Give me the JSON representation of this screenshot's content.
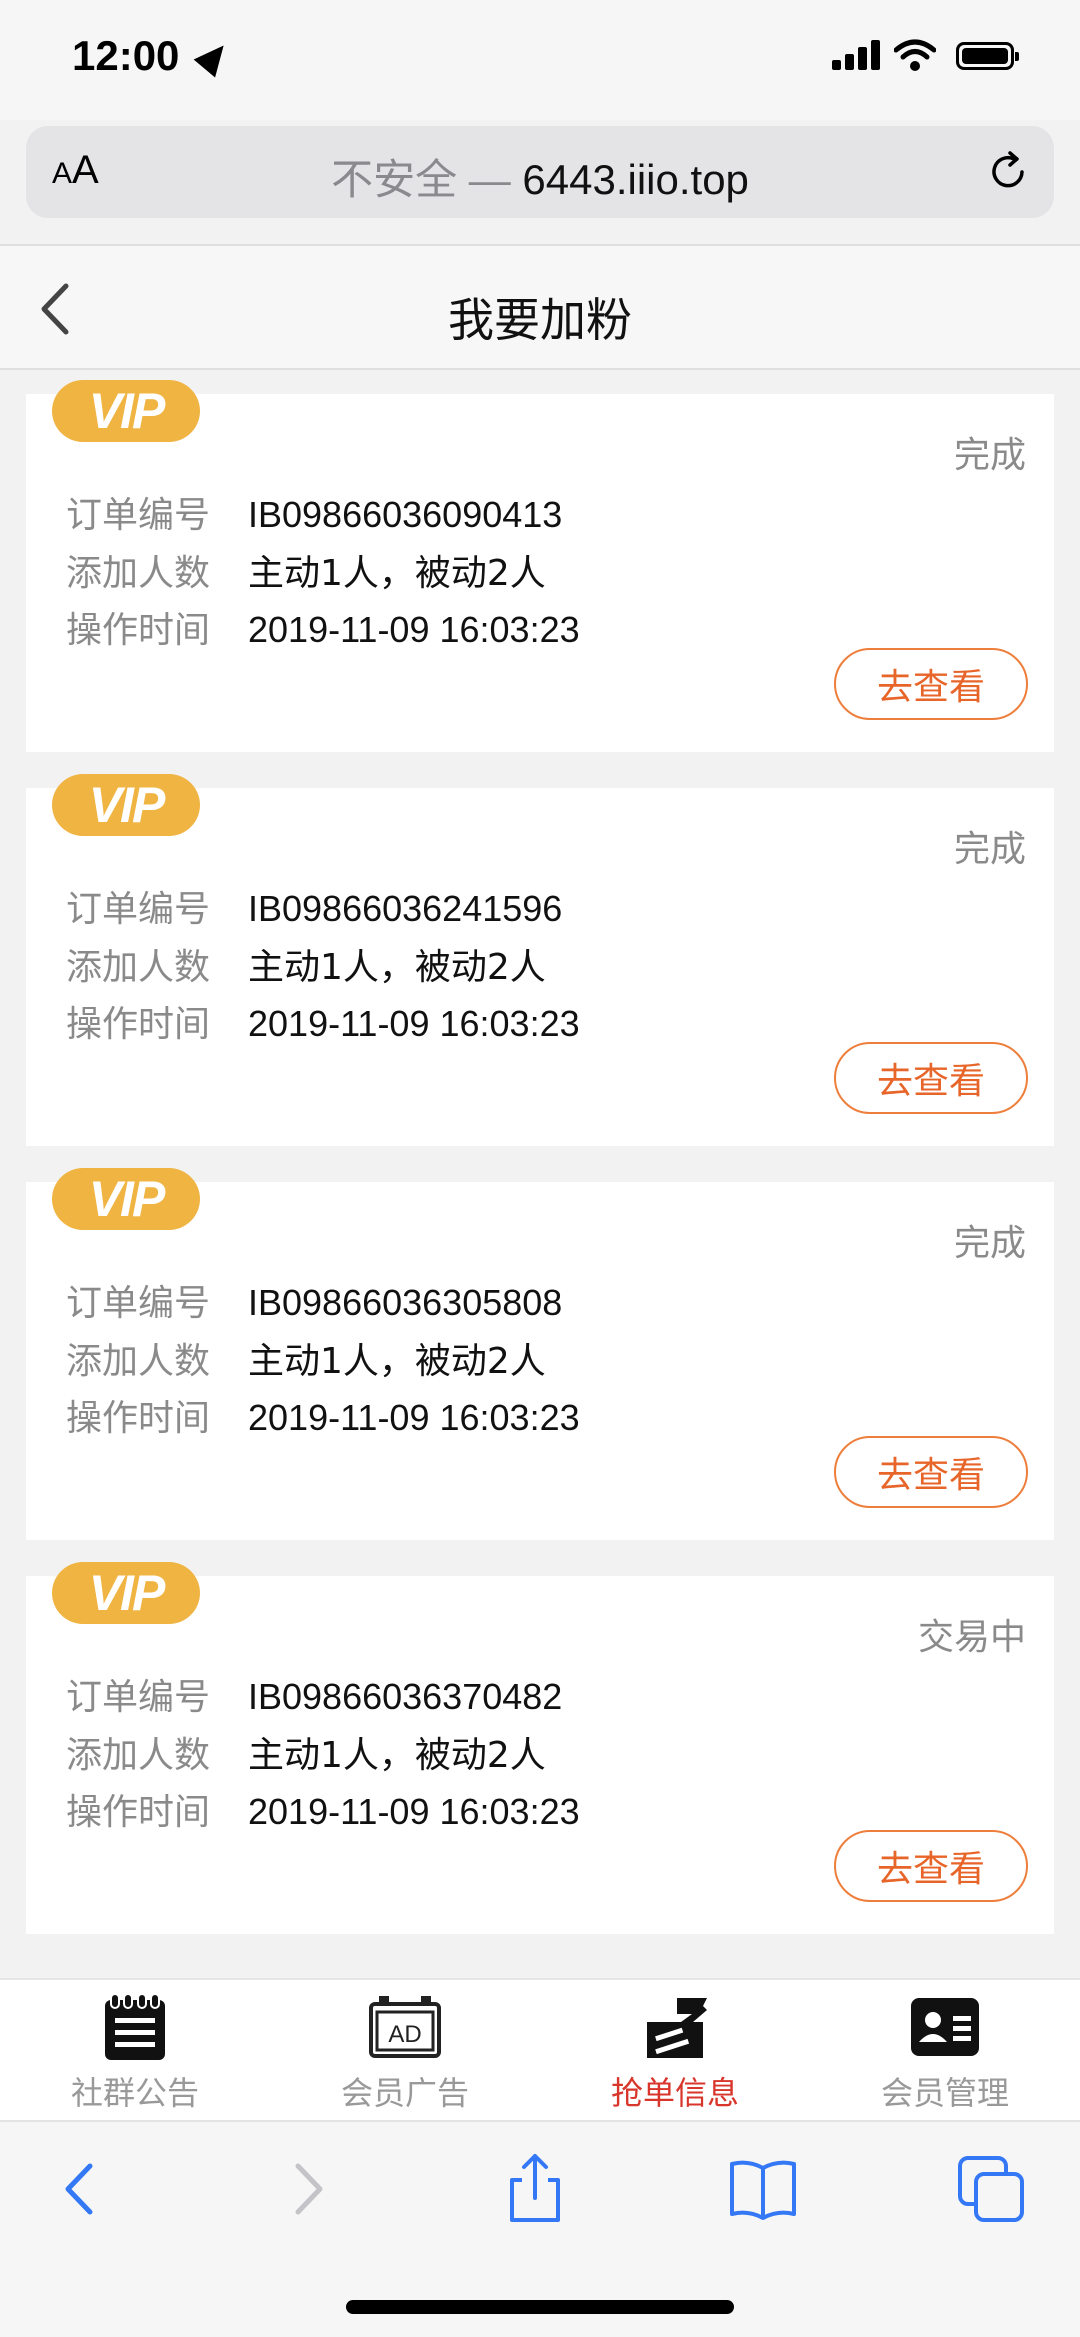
{
  "status_bar": {
    "time": "12:00"
  },
  "browser": {
    "aa_small": "A",
    "aa_big": "A",
    "insecure_label": "不安全 — ",
    "host": "6443.iiio.top"
  },
  "header": {
    "title": "我要加粉"
  },
  "labels": {
    "order_no": "订单编号",
    "add_count": "添加人数",
    "op_time": "操作时间",
    "view_button": "去查看",
    "vip": "VIP"
  },
  "orders": [
    {
      "status": "完成",
      "order_no": "IB09866036090413",
      "add_count": "主动1人，被动2人",
      "op_time": "2019-11-09 16:03:23"
    },
    {
      "status": "完成",
      "order_no": "IB09866036241596",
      "add_count": "主动1人，被动2人",
      "op_time": "2019-11-09 16:03:23"
    },
    {
      "status": "完成",
      "order_no": "IB09866036305808",
      "add_count": "主动1人，被动2人",
      "op_time": "2019-11-09 16:03:23"
    },
    {
      "status": "交易中",
      "order_no": "IB09866036370482",
      "add_count": "主动1人，被动2人",
      "op_time": "2019-11-09 16:03:23"
    }
  ],
  "tabs": [
    {
      "label": "社群公告",
      "icon": "notepad-icon",
      "active": false
    },
    {
      "label": "会员广告",
      "icon": "ad-icon",
      "active": false,
      "icon_text": "AD"
    },
    {
      "label": "抢单信息",
      "icon": "grab-order-icon",
      "active": true
    },
    {
      "label": "会员管理",
      "icon": "member-card-icon",
      "active": false
    }
  ],
  "colors": {
    "vip_badge": "#f0b442",
    "view_button": "#e8652a",
    "active_tab": "#d8352b",
    "safari_blue": "#3478f6"
  }
}
